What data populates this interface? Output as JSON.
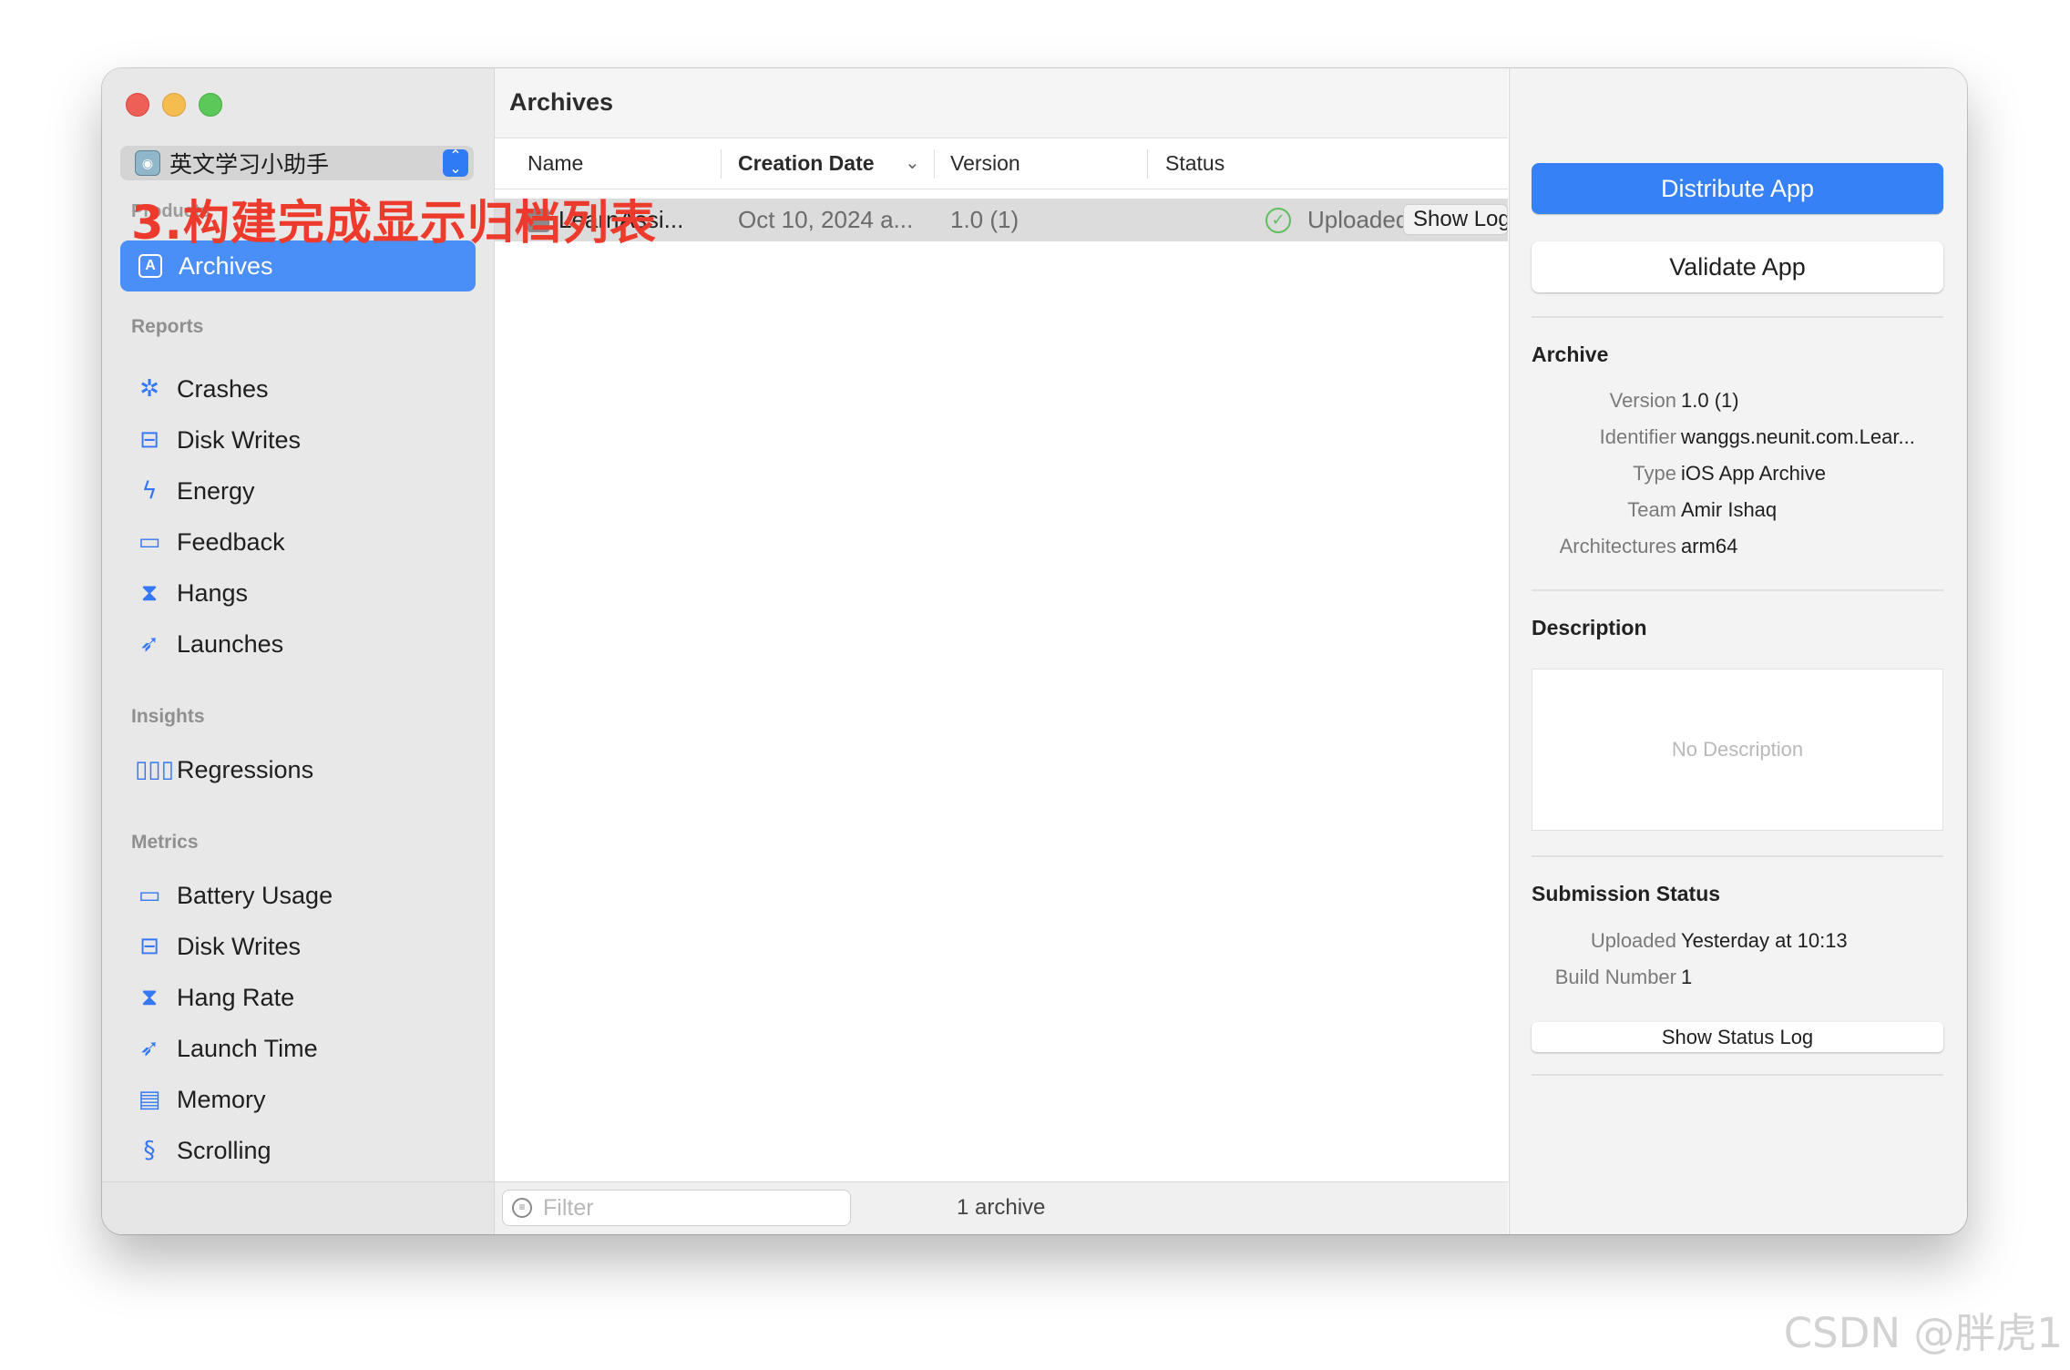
{
  "annotation": "3.构建完成显示归档列表",
  "watermark": "CSDN @胖虎1",
  "sidebar": {
    "product_name": "英文学习小助手",
    "ghost_section": "Products",
    "archives_label": "Archives",
    "reports_header": "Reports",
    "reports": [
      {
        "label": "Crashes",
        "icon": "crash-star-icon"
      },
      {
        "label": "Disk Writes",
        "icon": "disk-icon"
      },
      {
        "label": "Energy",
        "icon": "bolt-icon"
      },
      {
        "label": "Feedback",
        "icon": "speech-bubble-icon"
      },
      {
        "label": "Hangs",
        "icon": "hourglass-icon"
      },
      {
        "label": "Launches",
        "icon": "rocket-icon"
      }
    ],
    "insights_header": "Insights",
    "insights": [
      {
        "label": "Regressions",
        "icon": "bar-chart-icon"
      }
    ],
    "metrics_header": "Metrics",
    "metrics": [
      {
        "label": "Battery Usage",
        "icon": "battery-icon"
      },
      {
        "label": "Disk Writes",
        "icon": "disk-icon"
      },
      {
        "label": "Hang Rate",
        "icon": "hourglass-icon"
      },
      {
        "label": "Launch Time",
        "icon": "rocket-icon"
      },
      {
        "label": "Memory",
        "icon": "memory-chip-icon"
      },
      {
        "label": "Scrolling",
        "icon": "scroll-icon"
      }
    ]
  },
  "main": {
    "title": "Archives",
    "columns": {
      "name": "Name",
      "creation_date": "Creation Date",
      "version": "Version",
      "status": "Status"
    },
    "rows": [
      {
        "name": "LearnAssi...",
        "creation_date": "Oct 10, 2024 a...",
        "version": "1.0 (1)",
        "status": "Uploaded to A...",
        "action": "Show Log"
      }
    ],
    "filter_placeholder": "Filter",
    "archive_count": "1 archive"
  },
  "inspector": {
    "distribute_label": "Distribute App",
    "validate_label": "Validate App",
    "archive_heading": "Archive",
    "archive_fields": [
      {
        "key": "Version",
        "value": "1.0 (1)"
      },
      {
        "key": "Identifier",
        "value": "wanggs.neunit.com.Lear..."
      },
      {
        "key": "Type",
        "value": "iOS App Archive"
      },
      {
        "key": "Team",
        "value": "Amir Ishaq"
      },
      {
        "key": "Architectures",
        "value": "arm64"
      }
    ],
    "description_heading": "Description",
    "description_placeholder": "No Description",
    "submission_heading": "Submission Status",
    "submission_fields": [
      {
        "key": "Uploaded",
        "value": "Yesterday at 10:13"
      },
      {
        "key": "Build Number",
        "value": "1"
      }
    ],
    "status_log_label": "Show Status Log"
  },
  "colors": {
    "accent": "#3781f6",
    "selection": "#4a8ef7",
    "annotation": "#ec3a2c",
    "success": "#5cbf5c"
  }
}
